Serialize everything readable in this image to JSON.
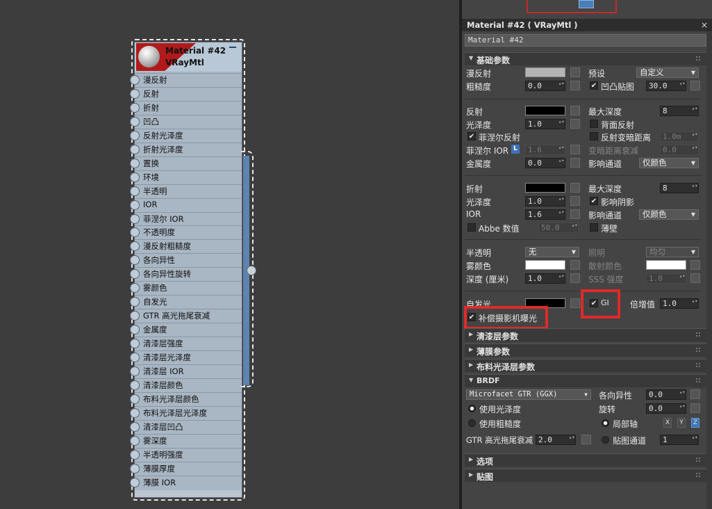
{
  "node": {
    "title": "Material #42",
    "subtitle": "VRayMtl",
    "slots": [
      "漫反射",
      "反射",
      "折射",
      "凹凸",
      "反射光泽度",
      "折射光泽度",
      "置换",
      "环境",
      "半透明",
      "IOR",
      "菲涅尔 IOR",
      "不透明度",
      "漫反射粗糙度",
      "各向异性",
      "各向异性旋转",
      "雾颜色",
      "自发光",
      "GTR 高光拖尾衰减",
      "金属度",
      "清漆层强度",
      "清漆层光泽度",
      "清漆层 IOR",
      "清漆层颜色",
      "布料光泽层颜色",
      "布料光泽层光泽度",
      "清漆层凹凸",
      "雾深度",
      "半透明强度",
      "薄膜厚度",
      "薄膜 IOR"
    ]
  },
  "panel": {
    "title": "Material #42  ( VRayMtl )",
    "close": "×",
    "name_value": "Material #42",
    "rollouts": {
      "basic": "基础参数",
      "coat": "清漆层参数",
      "film": "薄膜参数",
      "sheen": "布料光泽层参数",
      "brdf": "BRDF",
      "options": "选项",
      "maps": "贴图"
    },
    "colors": {
      "diffuse": "#b4b4b4",
      "reflect": "#000000",
      "refract": "#000000",
      "fog": "#ffffff",
      "scatter": "#ffffff",
      "self_illum": "#000000"
    },
    "diffuse": {
      "label": "漫反射",
      "preset_label": "预设",
      "preset_value": "自定义",
      "rough_label": "粗糙度",
      "rough_value": "0.0",
      "bump_label": "凹凸贴图",
      "bump_checked": "✔",
      "bump_value": "30.0"
    },
    "reflect": {
      "label": "反射",
      "maxdepth_label": "最大深度",
      "maxdepth_value": "8",
      "gloss_label": "光泽度",
      "gloss_value": "1.0",
      "backside_label": "背面反射",
      "fresnel_label": "菲涅尔反射",
      "fresnel_checked": "✔",
      "dimdist_label": "反射变暗距离",
      "dimdist_value": "1.0m",
      "fior_label": "菲涅尔 IOR",
      "fior_btn": "L",
      "fior_value": "1.6",
      "dimfall_label": "变暗距离衰减",
      "dimfall_value": "0.0",
      "metal_label": "金属度",
      "metal_value": "0.0",
      "affect_label": "影响通道",
      "affect_value": "仅颜色"
    },
    "refract": {
      "label": "折射",
      "maxdepth_label": "最大深度",
      "maxdepth_value": "8",
      "gloss_label": "光泽度",
      "gloss_value": "1.0",
      "shadow_label": "影响阴影",
      "shadow_checked": "✔",
      "ior_label": "IOR",
      "ior_value": "1.6",
      "affect_label": "影响通道",
      "affect_value": "仅颜色",
      "abbe_label": "Abbe 数值",
      "abbe_value": "50.0",
      "thin_label": "薄壁"
    },
    "translucency": {
      "label": "半透明",
      "value": "无",
      "illum_label": "照明",
      "illum_value": "均匀",
      "fog_label": "雾颜色",
      "scatter_label": "散射颜色",
      "depth_label": "深度 (厘米)",
      "depth_value": "1.0",
      "sss_label": "SSS 强度",
      "sss_value": "1.0"
    },
    "self": {
      "label": "自发光",
      "gi_label": "GI",
      "gi_checked": "✔",
      "mult_label": "倍增值",
      "mult_value": "1.0",
      "comp_label": "补偿摄影机曝光",
      "comp_checked": "✔"
    },
    "brdf": {
      "type_value": "Microfacet GTR (GGX)",
      "aniso_label": "各向异性",
      "aniso_value": "0.0",
      "use_gloss_label": "使用光泽度",
      "rot_label": "旋转",
      "rot_value": "0.0",
      "use_rough_label": "使用粗糙度",
      "local_label": "局部轴",
      "ax_x": "X",
      "ax_y": "Y",
      "ax_z": "Z",
      "gtr_label": "GTR 高光拖尾衰减",
      "gtr_value": "2.0",
      "mapch_label": "贴图通道",
      "mapch_value": "1"
    }
  }
}
